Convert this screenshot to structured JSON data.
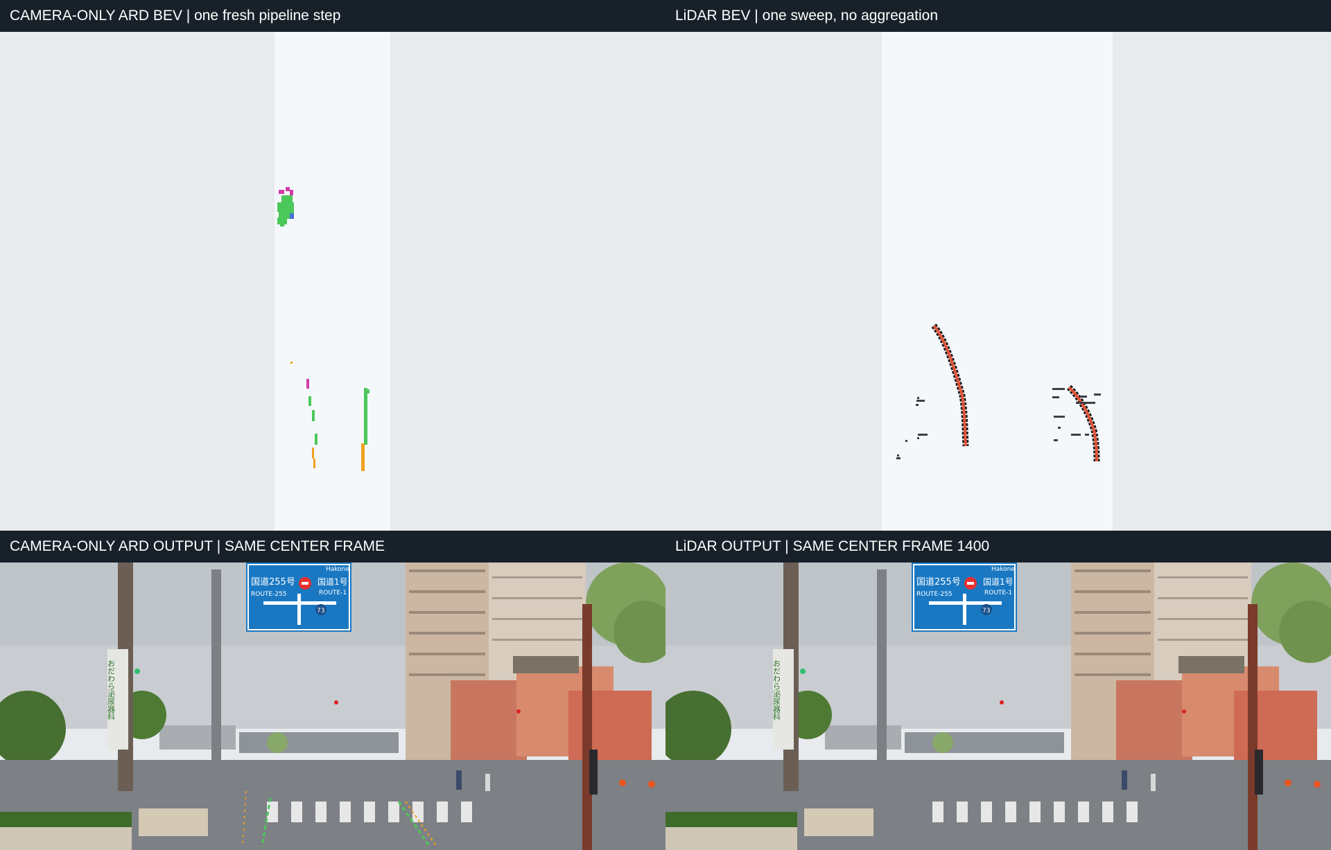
{
  "panels": {
    "camera_bev": {
      "title": "CAMERA-ONLY ARD BEV | one fresh pipeline step"
    },
    "lidar_bev": {
      "title": "LiDAR BEV | one sweep, no aggregation"
    },
    "camera_output": {
      "title": "CAMERA-ONLY ARD OUTPUT | SAME CENTER FRAME"
    },
    "lidar_output": {
      "title": "LiDAR OUTPUT | SAME CENTER FRAME 1400"
    }
  },
  "colors": {
    "header_bg": "#18212a",
    "bev_bg": "#e7ebee",
    "bev_roi": "#f4f8fb",
    "lane_green": "#4cc85a",
    "lane_orange": "#f0a020",
    "magenta": "#d23ca8",
    "blue": "#4a6fd8",
    "lidar_red": "#e0553a",
    "lidar_dark": "#3a3f48",
    "sign_blue": "#1a78c2"
  },
  "scene_text": {
    "route_left": "国道255号",
    "route_left_en": "ROUTE-255",
    "route_right": "国道1号",
    "route_right_en": "ROUTE-1",
    "destination_en": "Hakone",
    "route_number": "73",
    "banner_left": "おだわら泌尿器科"
  }
}
